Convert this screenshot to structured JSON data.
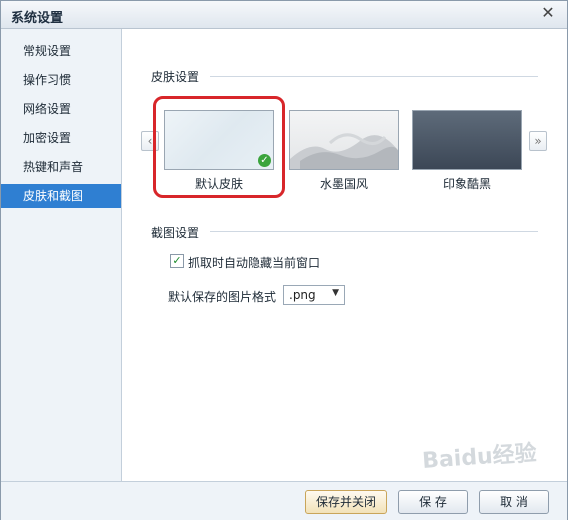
{
  "window": {
    "title": "系统设置",
    "close_symbol": "✕"
  },
  "sidebar": {
    "items": [
      {
        "label": "常规设置",
        "active": false
      },
      {
        "label": "操作习惯",
        "active": false
      },
      {
        "label": "网络设置",
        "active": false
      },
      {
        "label": "加密设置",
        "active": false
      },
      {
        "label": "热键和声音",
        "active": false
      },
      {
        "label": "皮肤和截图",
        "active": true
      }
    ]
  },
  "skin_section": {
    "title": "皮肤设置",
    "prev_arrow": "‹",
    "next_arrow": "»",
    "skins": [
      {
        "label": "默认皮肤",
        "selected": true
      },
      {
        "label": "水墨国风",
        "selected": false
      },
      {
        "label": "印象酷黑",
        "selected": false
      }
    ],
    "selected_check": "✓"
  },
  "screenshot_section": {
    "title": "截图设置",
    "hide_window": {
      "label": "抓取时自动隐藏当前窗口",
      "checked": true,
      "check_mark": "✓"
    },
    "format": {
      "label": "默认保存的图片格式",
      "value": ".png"
    }
  },
  "footer": {
    "save_close": "保存并关闭",
    "save": "保 存",
    "cancel": "取 消"
  },
  "watermark": "Baidu经验",
  "colors": {
    "accent": "#2f7fd2",
    "highlight": "#d8262a",
    "check": "#3aa43c"
  }
}
